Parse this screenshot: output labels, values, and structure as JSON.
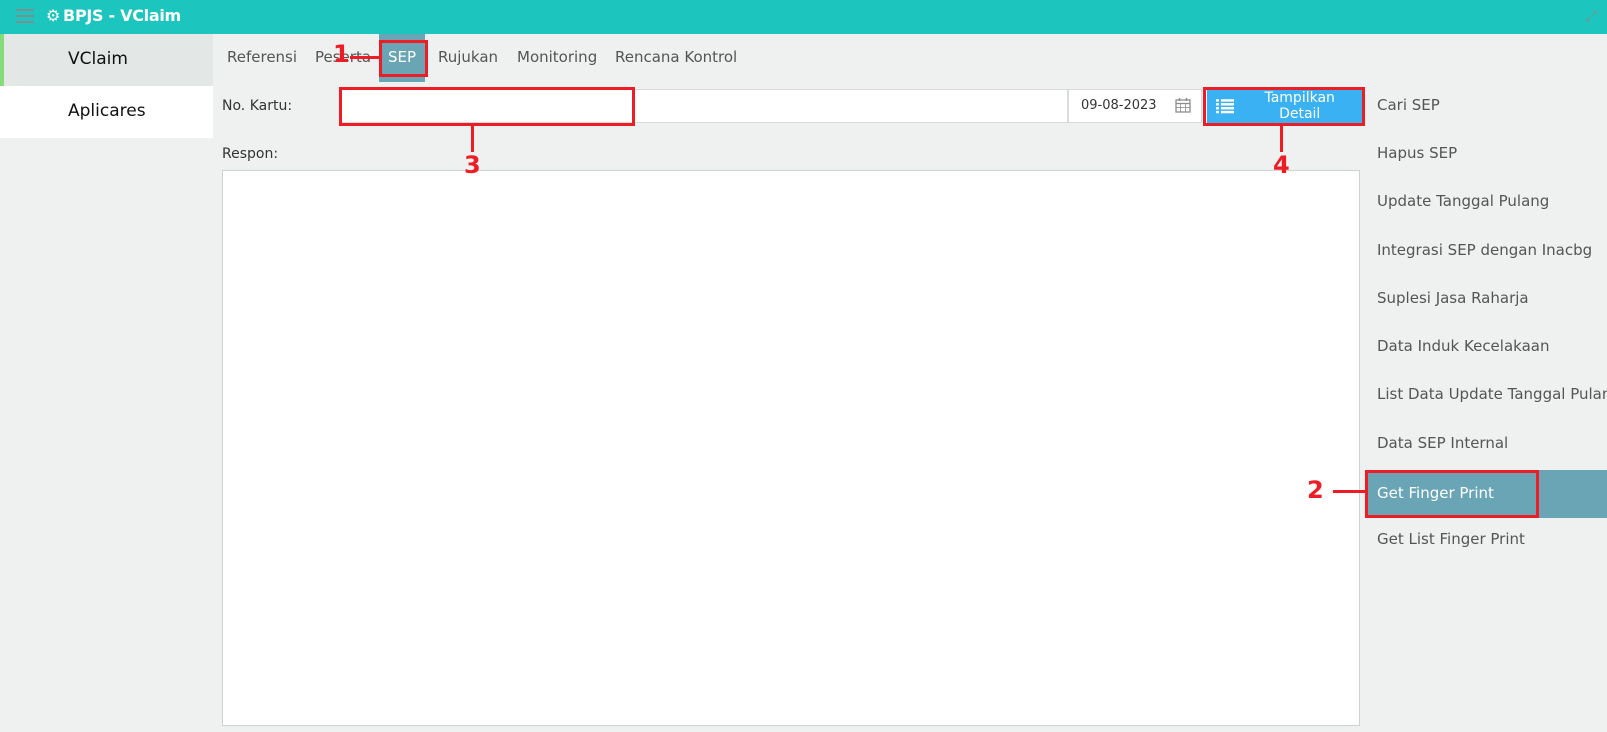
{
  "app": {
    "title": "BPJS - VClaim"
  },
  "sidebar": {
    "items": [
      {
        "label": "VClaim"
      },
      {
        "label": "Aplicares"
      }
    ]
  },
  "tabs": [
    {
      "label": "Referensi"
    },
    {
      "label": "Peserta"
    },
    {
      "label": "SEP"
    },
    {
      "label": "Rujukan"
    },
    {
      "label": "Monitoring"
    },
    {
      "label": "Rencana Kontrol"
    }
  ],
  "form": {
    "no_kartu_label": "No. Kartu:",
    "no_kartu_value": "",
    "date_value": "09-08-2023",
    "detail_button": "Tampilkan Detail",
    "respon_label": "Respon:"
  },
  "right_menu": [
    {
      "label": "Cari SEP"
    },
    {
      "label": "Hapus SEP"
    },
    {
      "label": "Update Tanggal Pulang"
    },
    {
      "label": "Integrasi SEP dengan Inacbg"
    },
    {
      "label": "Suplesi Jasa Raharja"
    },
    {
      "label": "Data Induk Kecelakaan"
    },
    {
      "label": "List Data Update Tanggal Pulang"
    },
    {
      "label": "Data SEP Internal"
    },
    {
      "label": "Get Finger Print"
    },
    {
      "label": "Get List Finger Print"
    }
  ],
  "annotations": {
    "one": "1",
    "two": "2",
    "three": "3",
    "four": "4"
  },
  "colors": {
    "header": "#1cc6bf",
    "active_tab": "#6aa5b5",
    "button": "#39b1f2",
    "annotation": "#ee1c25",
    "sidebar_accent": "#85dd7a"
  },
  "icons": {
    "menu": "hamburger-icon",
    "logo": "gear-icon",
    "fullscreen": "expand-icon",
    "calendar": "calendar-icon",
    "list": "list-icon"
  }
}
